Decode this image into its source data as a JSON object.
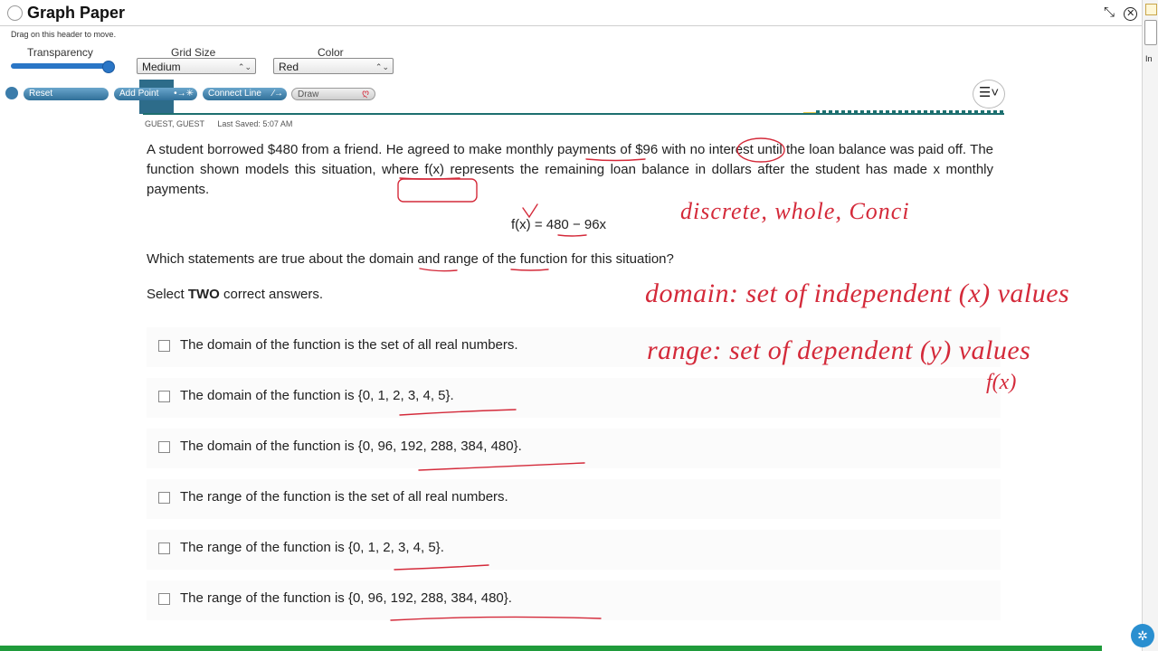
{
  "header": {
    "title": "Graph Paper",
    "drag_hint": "Drag on this header to move.",
    "transparency_label": "Transparency",
    "transparency_value": 1.0,
    "grid_size_label": "Grid Size",
    "grid_size_value": "Medium",
    "color_label": "Color",
    "color_value": "Red",
    "close_icon": "close-icon",
    "collapse_icon": "collapse-icon"
  },
  "toolbar": {
    "reset_label": "Reset",
    "add_point_label": "Add Point",
    "connect_line_label": "Connect Line",
    "draw_label": "Draw",
    "menu_icon": "menu-icon"
  },
  "user": {
    "name": "GUEST, GUEST",
    "last_saved": "Last Saved: 5:07 AM"
  },
  "question": {
    "text": "A student borrowed $480 from a friend. He agreed to make monthly payments of $96 with no interest until the loan balance was paid off. The function shown models this situation, where f(x) represents the remaining loan balance in dollars after the student has made x monthly payments.",
    "formula": "f(x) = 480 − 96x",
    "prompt": "Which statements are true about the domain and range of the function for this situation?",
    "select_prefix": "Select ",
    "select_bold": "TWO",
    "select_suffix": " correct answers."
  },
  "options": [
    "The domain of the function is the set of all real numbers.",
    "The domain of the function is {0, 1, 2, 3, 4, 5}.",
    "The domain of the function is {0, 96, 192, 288, 384, 480}.",
    "The range of the function is the set of all real numbers.",
    "The range of the function is {0, 1, 2, 3, 4, 5}.",
    "The range of the function is {0, 96, 192, 288, 384, 480}."
  ],
  "annotations": {
    "note1": "discrete, whole, Conci",
    "note2": "domain: set of independent (x) values",
    "note3": "range: set of dependent (y) values",
    "note4": "f(x)",
    "ink_color": "#d42a3a"
  },
  "side": {
    "label_in": "In"
  }
}
